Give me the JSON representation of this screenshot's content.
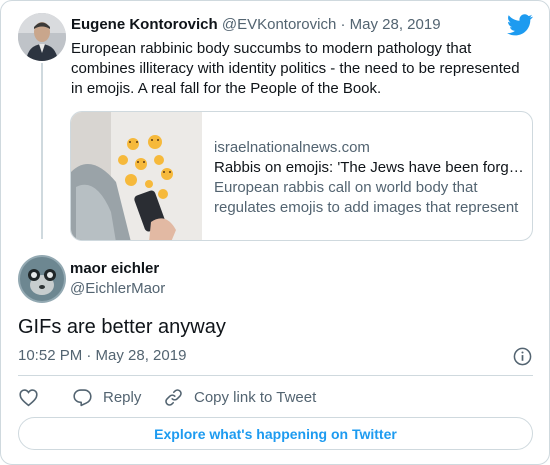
{
  "colors": {
    "accent": "#1d9bf0",
    "text": "#0f1419",
    "muted": "#536471",
    "border": "#cfd9de"
  },
  "parent_tweet": {
    "author_name": "Eugene Kontorovich",
    "author_handle": "@EVKontorovich",
    "separator": "·",
    "date": "May 28, 2019",
    "text": "European rabbinic body succumbs to modern pathology that combines illiteracy with identity politics - the need to be represented in emojis. A real fall for the People of the Book.",
    "link_card": {
      "domain": "israelnationalnews.com",
      "title": "Rabbis on emojis: 'The Jews have been forgotten'",
      "description": "European rabbis call on world body that regulates emojis to add images that represent Jewish life."
    }
  },
  "reply_tweet": {
    "author_name": "maor eichler",
    "author_handle": "@EichlerMaor",
    "text": "GIFs are better anyway",
    "timestamp": "10:52 PM · May 28, 2019"
  },
  "actions": {
    "reply_label": "Reply",
    "copy_link_label": "Copy link to Tweet"
  },
  "icons": [
    "twitter-bird-icon",
    "info-icon",
    "heart-icon",
    "reply-icon",
    "link-icon"
  ],
  "explore_label": "Explore what's happening on Twitter"
}
